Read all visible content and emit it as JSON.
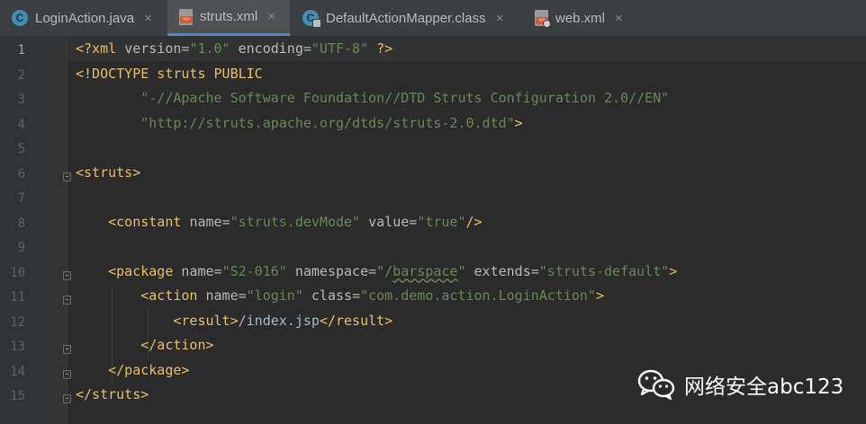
{
  "tabs": [
    {
      "label": "LoginAction.java",
      "icon": "java-class-icon",
      "active": false
    },
    {
      "label": "struts.xml",
      "icon": "xml-file-icon",
      "active": true
    },
    {
      "label": "DefaultActionMapper.class",
      "icon": "compiled-class-icon",
      "active": false
    },
    {
      "label": "web.xml",
      "icon": "web-xml-file-icon",
      "active": false
    }
  ],
  "tab_close_glyph": "×",
  "colors": {
    "background": "#2b2b2b",
    "gutter": "#313335",
    "tag": "#e8bf6a",
    "attribute": "#bababa",
    "string": "#6a8759",
    "text": "#a9b7c6",
    "active_tab_underline": "#4a88c7"
  },
  "editor": {
    "current_line": 1,
    "lines": [
      [
        {
          "t": "tag",
          "s": "<?xml "
        },
        {
          "t": "attr",
          "s": "version"
        },
        {
          "t": "text",
          "s": "="
        },
        {
          "t": "val",
          "s": "\"1.0\""
        },
        {
          "t": "text",
          "s": " "
        },
        {
          "t": "attr",
          "s": "encoding"
        },
        {
          "t": "text",
          "s": "="
        },
        {
          "t": "val",
          "s": "\"UTF-8\""
        },
        {
          "t": "text",
          "s": " "
        },
        {
          "t": "tag",
          "s": "?>"
        }
      ],
      [
        {
          "t": "tag",
          "s": "<!DOCTYPE struts PUBLIC"
        }
      ],
      [
        {
          "t": "text",
          "s": "        "
        },
        {
          "t": "val",
          "s": "\"-//Apache Software Foundation//DTD Struts Configuration 2.0//EN\""
        }
      ],
      [
        {
          "t": "text",
          "s": "        "
        },
        {
          "t": "val",
          "s": "\"http://struts.apache.org/dtds/struts-2.0.dtd\""
        },
        {
          "t": "tag",
          "s": ">"
        }
      ],
      [],
      [
        {
          "t": "tag",
          "s": "<struts>"
        }
      ],
      [],
      [
        {
          "t": "text",
          "s": "    "
        },
        {
          "t": "tag",
          "s": "<constant "
        },
        {
          "t": "attr",
          "s": "name"
        },
        {
          "t": "text",
          "s": "="
        },
        {
          "t": "val",
          "s": "\"struts.devMode\""
        },
        {
          "t": "text",
          "s": " "
        },
        {
          "t": "attr",
          "s": "value"
        },
        {
          "t": "text",
          "s": "="
        },
        {
          "t": "val",
          "s": "\"true\""
        },
        {
          "t": "tag",
          "s": "/>"
        }
      ],
      [],
      [
        {
          "t": "text",
          "s": "    "
        },
        {
          "t": "tag",
          "s": "<package "
        },
        {
          "t": "attr",
          "s": "name"
        },
        {
          "t": "text",
          "s": "="
        },
        {
          "t": "val",
          "s": "\"S2-016\""
        },
        {
          "t": "text",
          "s": " "
        },
        {
          "t": "attr",
          "s": "namespace"
        },
        {
          "t": "text",
          "s": "="
        },
        {
          "t": "val",
          "s": "\"/"
        },
        {
          "t": "val",
          "s": "barspace",
          "typo": true
        },
        {
          "t": "val",
          "s": "\""
        },
        {
          "t": "text",
          "s": " "
        },
        {
          "t": "attr",
          "s": "extends"
        },
        {
          "t": "text",
          "s": "="
        },
        {
          "t": "val",
          "s": "\"struts-default\""
        },
        {
          "t": "tag",
          "s": ">"
        }
      ],
      [
        {
          "t": "text",
          "s": "        "
        },
        {
          "t": "tag",
          "s": "<action "
        },
        {
          "t": "attr",
          "s": "name"
        },
        {
          "t": "text",
          "s": "="
        },
        {
          "t": "val",
          "s": "\"login\""
        },
        {
          "t": "text",
          "s": " "
        },
        {
          "t": "attr",
          "s": "class"
        },
        {
          "t": "text",
          "s": "="
        },
        {
          "t": "val",
          "s": "\"com.demo.action.LoginAction\""
        },
        {
          "t": "tag",
          "s": ">"
        }
      ],
      [
        {
          "t": "text",
          "s": "            "
        },
        {
          "t": "tag",
          "s": "<result>"
        },
        {
          "t": "text",
          "s": "/index.jsp"
        },
        {
          "t": "tag",
          "s": "</result>"
        }
      ],
      [
        {
          "t": "text",
          "s": "        "
        },
        {
          "t": "tag",
          "s": "</action>"
        }
      ],
      [
        {
          "t": "text",
          "s": "    "
        },
        {
          "t": "tag",
          "s": "</package>"
        }
      ],
      [
        {
          "t": "tag",
          "s": "</struts>"
        }
      ]
    ]
  },
  "watermark": {
    "text": "网络安全abc123",
    "icon": "wechat-logo-icon"
  }
}
